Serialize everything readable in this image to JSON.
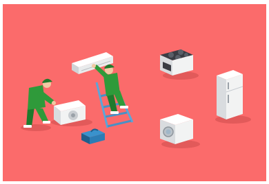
{
  "scene": {
    "subject": "home-appliance-installation-illustration",
    "colors": {
      "background": "#fb6b6b",
      "uniform": "#2f9a3a",
      "uniform_dark": "#1f7a2c",
      "skin": "#f1c9a3",
      "appliance_white": "#f2f3f3",
      "appliance_shade": "#d9dcdf",
      "ladder": "#5aa6d9",
      "toolbox": "#2c7db5",
      "stove_dark": "#3a3d44"
    },
    "items": [
      {
        "name": "technician-kneeling",
        "type": "person"
      },
      {
        "name": "technician-on-ladder",
        "type": "person"
      },
      {
        "name": "air-conditioner-indoor-unit",
        "type": "appliance"
      },
      {
        "name": "air-conditioner-outdoor-unit",
        "type": "appliance"
      },
      {
        "name": "step-ladder",
        "type": "tool"
      },
      {
        "name": "toolbox",
        "type": "tool"
      },
      {
        "name": "electric-stove",
        "type": "appliance"
      },
      {
        "name": "refrigerator",
        "type": "appliance"
      },
      {
        "name": "washing-machine",
        "type": "appliance"
      }
    ]
  }
}
